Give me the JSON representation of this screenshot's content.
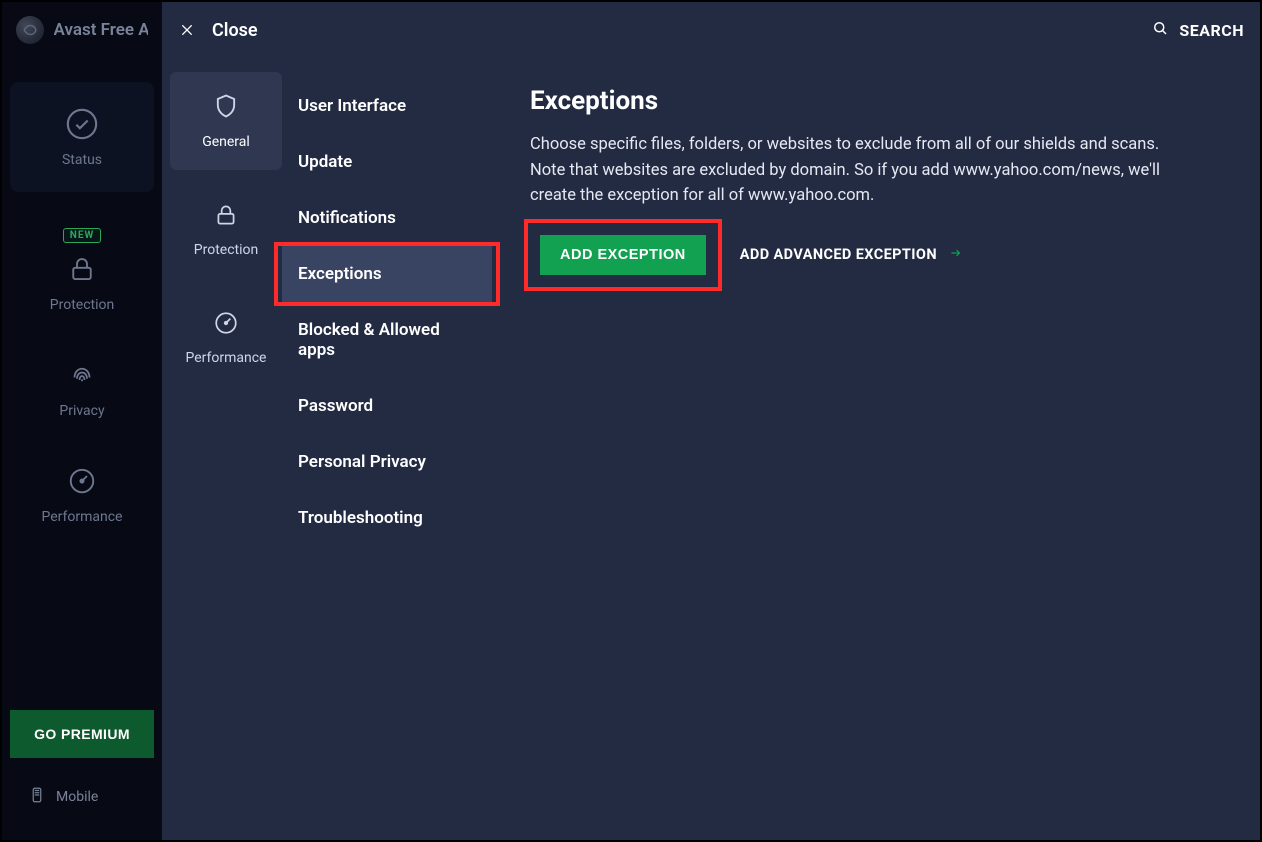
{
  "app": {
    "name": "Avast Free A"
  },
  "leftnav": {
    "status": "Status",
    "protection": "Protection",
    "privacy": "Privacy",
    "performance": "Performance",
    "new_badge": "NEW",
    "go_premium": "GO PREMIUM",
    "mobile": "Mobile"
  },
  "overlay": {
    "close": "Close",
    "search": "SEARCH"
  },
  "categories": {
    "general": "General",
    "protection": "Protection",
    "performance": "Performance"
  },
  "sub": {
    "ui": "User Interface",
    "update": "Update",
    "notifications": "Notifications",
    "exceptions": "Exceptions",
    "blocked_allowed": "Blocked & Allowed apps",
    "password": "Password",
    "personal_privacy": "Personal Privacy",
    "troubleshooting": "Troubleshooting"
  },
  "content": {
    "title": "Exceptions",
    "desc": "Choose specific files, folders, or websites to exclude from all of our shields and scans. Note that websites are excluded by domain. So if you add www.yahoo.com/news, we'll create the exception for all of www.yahoo.com.",
    "add_exception": "ADD EXCEPTION",
    "add_advanced": "ADD ADVANCED EXCEPTION"
  }
}
